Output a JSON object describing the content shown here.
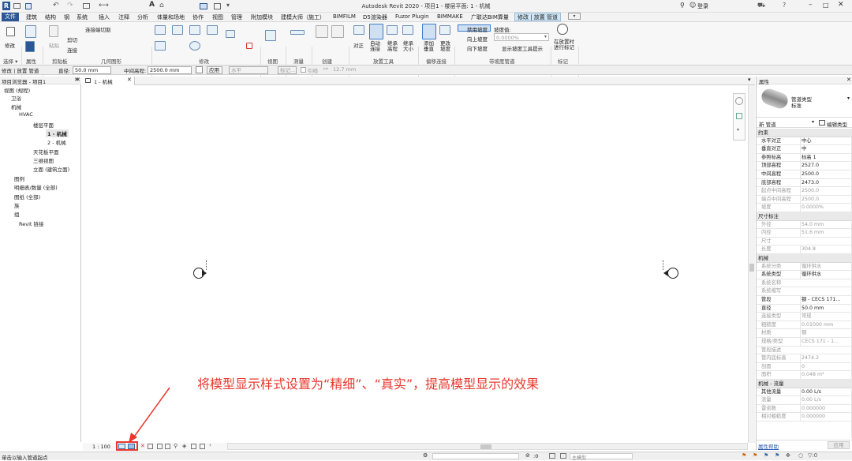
{
  "title_bar": {
    "app_title": "Autodesk Revit 2020 - 项目1 - 楼层平面: 1 - 机械",
    "login_label": "登录"
  },
  "menu": {
    "items": [
      "文件",
      "建筑",
      "结构",
      "钢",
      "系统",
      "插入",
      "注释",
      "分析",
      "体量和场地",
      "协作",
      "视图",
      "管理",
      "附加模块",
      "建模大师（施工）",
      "BIMFILM",
      "D5渲染器",
      "Fuzor Plugin",
      "BIMMAKE",
      "广联达BIM算量"
    ],
    "context_tab": "修改 | 放置 管道"
  },
  "ribbon": {
    "modify_label": "修改",
    "paste_label": "粘贴",
    "cut_label": "剪切",
    "join_label": "连接",
    "cope_label": "连接端切割",
    "select_group": "选择 ▾",
    "properties_group": "属性",
    "clipboard_group": "剪贴板",
    "geometry_group": "几何图形",
    "modify_group": "修改",
    "view_group": "视图",
    "measure_group": "测量",
    "create_group": "创建",
    "placement_tools_group": "放置工具",
    "offset_group": "偏移连接",
    "slope_group": "带坡度管道",
    "tag_group": "标记",
    "justify_label": "对正",
    "auto_connect_label": "自动\n连接",
    "inherit_elev_label": "继承\n高程",
    "inherit_size_label": "继承\n大小",
    "add_vertical_label": "添加\n垂直",
    "change_slope_label": "更改\n坡度",
    "disable_slope_label": "禁用坡度",
    "slope_up_label": "向上坡度",
    "slope_down_label": "向下坡度",
    "slope_value_label": "坡度值:",
    "slope_value": "0.0000%",
    "show_slope_tooltip_label": "显示坡度工具提示",
    "tag_on_place_label": "在放置时\n进行标记"
  },
  "options_bar": {
    "context_label": "修改 | 放置 管道",
    "diameter_label": "直径:",
    "diameter_value": "50.0 mm",
    "middle_elev_label": "中间高程:",
    "middle_elev_value": "2500.0 mm",
    "apply_label": "应用",
    "horizontal_value": "水平",
    "tag_label": "标记...",
    "lead_label": "引线",
    "lead_length": "12.7 mm"
  },
  "project_browser": {
    "title": "项目浏览器 - 项目1",
    "items": [
      {
        "text": "视图 (规程)"
      },
      {
        "text": "卫浴"
      },
      {
        "text": "机械"
      },
      {
        "text": "HVAC"
      },
      {
        "text": "楼层平面"
      },
      {
        "text": "1 - 机械"
      },
      {
        "text": "2 - 机械"
      },
      {
        "text": "天花板平面"
      },
      {
        "text": "三维视图"
      },
      {
        "text": "立面 (建筑立面)"
      },
      {
        "text": "图例"
      },
      {
        "text": "明细表/数量 (全部)"
      },
      {
        "text": "图纸 (全部)"
      },
      {
        "text": "族"
      },
      {
        "text": "组"
      },
      {
        "text": "Revit 链接"
      }
    ]
  },
  "view_tab": {
    "label": "1 - 机械"
  },
  "annotation": {
    "text": "将模型显示样式设置为“精细”、“真实”，提高模型显示的效果"
  },
  "view_control_bar": {
    "scale": "1 : 100"
  },
  "properties": {
    "title": "属性",
    "type_family": "管道类型",
    "type_name": "标准",
    "instance_selector": "新 管道",
    "edit_type_label": "编辑类型",
    "apply_label": "应用",
    "help_label": "属性帮助",
    "sections": [
      {
        "title": "约束",
        "rows": [
          {
            "k": "水平对正",
            "v": "中心",
            "grey": false
          },
          {
            "k": "垂直对正",
            "v": "中",
            "grey": false
          },
          {
            "k": "参照标高",
            "v": "标高 1",
            "grey": false
          },
          {
            "k": "顶部高程",
            "v": "2527.0",
            "grey": false
          },
          {
            "k": "中间高程",
            "v": "2500.0",
            "grey": false
          },
          {
            "k": "底部高程",
            "v": "2473.0",
            "grey": false
          },
          {
            "k": "起点中间高程",
            "v": "2500.0",
            "grey": true
          },
          {
            "k": "端点中间高程",
            "v": "2500.0",
            "grey": true
          },
          {
            "k": "坡度",
            "v": "0.0000%",
            "grey": true
          }
        ]
      },
      {
        "title": "尺寸标注",
        "rows": [
          {
            "k": "外径",
            "v": "54.0 mm",
            "grey": true
          },
          {
            "k": "内径",
            "v": "51.6 mm",
            "grey": true
          },
          {
            "k": "尺寸",
            "v": "",
            "grey": true
          },
          {
            "k": "长度",
            "v": "304.8",
            "grey": true
          }
        ]
      },
      {
        "title": "机械",
        "rows": [
          {
            "k": "系统分类",
            "v": "循环供水",
            "grey": true
          },
          {
            "k": "系统类型",
            "v": "循环供水",
            "grey": false
          },
          {
            "k": "系统名称",
            "v": "",
            "grey": true
          },
          {
            "k": "系统缩写",
            "v": "",
            "grey": true
          },
          {
            "k": "管段",
            "v": "钢 - CECS 171...",
            "grey": false
          },
          {
            "k": "直径",
            "v": "50.0 mm",
            "grey": false
          },
          {
            "k": "连接类型",
            "v": "常规",
            "grey": true
          },
          {
            "k": "粗糙度",
            "v": "0.01000 mm",
            "grey": true
          },
          {
            "k": "材质",
            "v": "钢",
            "grey": true
          },
          {
            "k": "规格/类型",
            "v": "CECS 171 - 1...",
            "grey": true
          },
          {
            "k": "管段描述",
            "v": "",
            "grey": true
          },
          {
            "k": "管内底标高",
            "v": "2474.2",
            "grey": true
          },
          {
            "k": "剖面",
            "v": "0",
            "grey": true
          },
          {
            "k": "面积",
            "v": "0.048 m²",
            "grey": true
          }
        ]
      },
      {
        "title": "机械 - 流量",
        "rows": [
          {
            "k": "其他流量",
            "v": "0.00 L/s",
            "grey": false
          },
          {
            "k": "流量",
            "v": "0.00 L/s",
            "grey": true
          },
          {
            "k": "雷诺数",
            "v": "0.000000",
            "grey": true
          },
          {
            "k": "相对粗糙度",
            "v": "0.000000",
            "grey": true
          }
        ]
      }
    ]
  },
  "status_bar": {
    "prompt": "单击以输入管道起点",
    "main_model": "主模型",
    "zero": ":0"
  },
  "colors": {
    "annotation_red": "#e8382d",
    "file_tab_blue": "#2b5797",
    "context_tab_fill": "#cfe5f5"
  }
}
